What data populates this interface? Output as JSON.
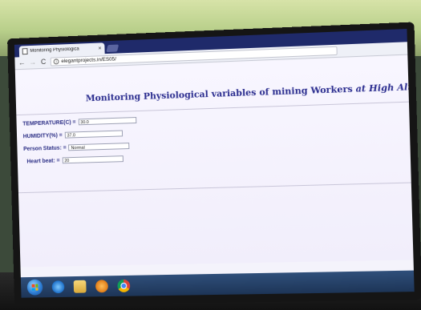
{
  "browser": {
    "tab_title": "Monitoring Physiologica",
    "tab_close": "×",
    "back": "←",
    "forward": "→",
    "reload": "C",
    "info": "i",
    "url": "elegantprojects.in/ES05/"
  },
  "page": {
    "title_regular": "Monitoring Physiological variables of mining Workers ",
    "title_italic": "at High Altitude",
    "fields": [
      {
        "label": "TEMPERATURE(C) =",
        "value": "30.0"
      },
      {
        "label": "HUMIDITY(%) =",
        "value": "37.0"
      },
      {
        "label": "Person Status: =",
        "value": "Normal"
      },
      {
        "label": "Heart beat: =",
        "value": "20"
      }
    ]
  },
  "taskbar": {
    "items": [
      "start-button",
      "internet-explorer",
      "file-explorer",
      "media-player",
      "google-chrome"
    ]
  }
}
